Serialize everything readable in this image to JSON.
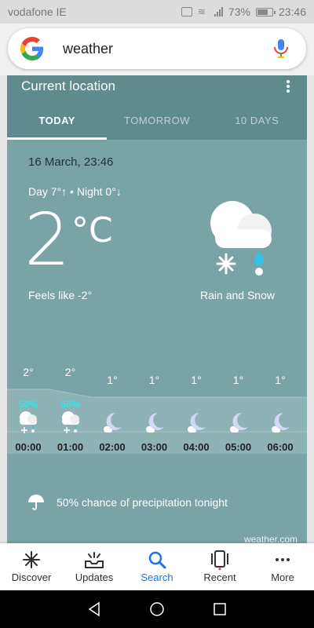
{
  "status_bar": {
    "carrier": "vodafone IE",
    "battery": "73%",
    "time": "23:46"
  },
  "search": {
    "query": "weather"
  },
  "card": {
    "title": "Current location",
    "tabs": [
      "TODAY",
      "TOMORROW",
      "10 DAYS"
    ],
    "date": "16 March, 23:46",
    "day_night": "Day 7°↑ • Night 0°↓",
    "temperature": "2",
    "unit": "°C",
    "feels_like": "Feels like -2°",
    "condition": "Rain and Snow",
    "hourly": [
      {
        "time": "00:00",
        "temp": "2°",
        "precip": "50%",
        "icon": "cloud-snow-icon"
      },
      {
        "time": "01:00",
        "temp": "2°",
        "precip": "50%",
        "icon": "cloud-snow-icon"
      },
      {
        "time": "02:00",
        "temp": "1°",
        "precip": "",
        "icon": "moon-cloud-icon"
      },
      {
        "time": "03:00",
        "temp": "1°",
        "precip": "",
        "icon": "moon-cloud-icon"
      },
      {
        "time": "04:00",
        "temp": "1°",
        "precip": "",
        "icon": "moon-cloud-icon"
      },
      {
        "time": "05:00",
        "temp": "1°",
        "precip": "",
        "icon": "moon-cloud-icon"
      },
      {
        "time": "06:00",
        "temp": "1°",
        "precip": "",
        "icon": "moon-cloud-icon"
      }
    ],
    "precip_text": "50% chance of precipitation tonight",
    "source": "weather.com"
  },
  "nav": [
    {
      "label": "Discover",
      "icon": "asterisk-icon"
    },
    {
      "label": "Updates",
      "icon": "updates-icon"
    },
    {
      "label": "Search",
      "icon": "search-icon"
    },
    {
      "label": "Recent",
      "icon": "recent-icon"
    },
    {
      "label": "More",
      "icon": "more-icon"
    }
  ]
}
